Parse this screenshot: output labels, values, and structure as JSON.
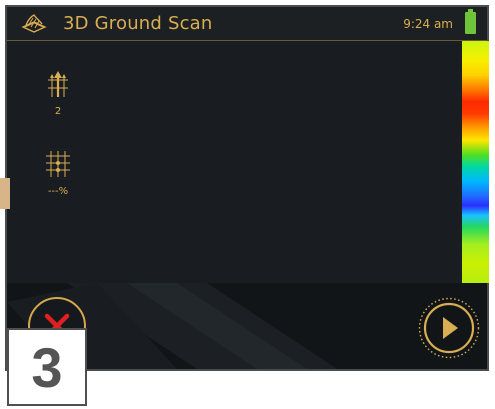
{
  "header": {
    "title": "3D Ground Scan",
    "time": "9:24 am",
    "logo_icon": "ground-scan-logo-icon",
    "battery_icon": "battery-icon"
  },
  "tools": {
    "passes": {
      "icon": "passes-arrows-icon",
      "value": "2"
    },
    "grid": {
      "icon": "grid-icon",
      "value": "---%"
    }
  },
  "footer": {
    "cancel_icon": "cancel-x-icon",
    "play_icon": "play-icon"
  },
  "step_badge": {
    "number": "3"
  },
  "colors": {
    "accent": "#d9ae52",
    "background": "#1b1f22",
    "cancel": "#e02020",
    "battery": "#6fc43a",
    "handle": "#d8b589"
  }
}
